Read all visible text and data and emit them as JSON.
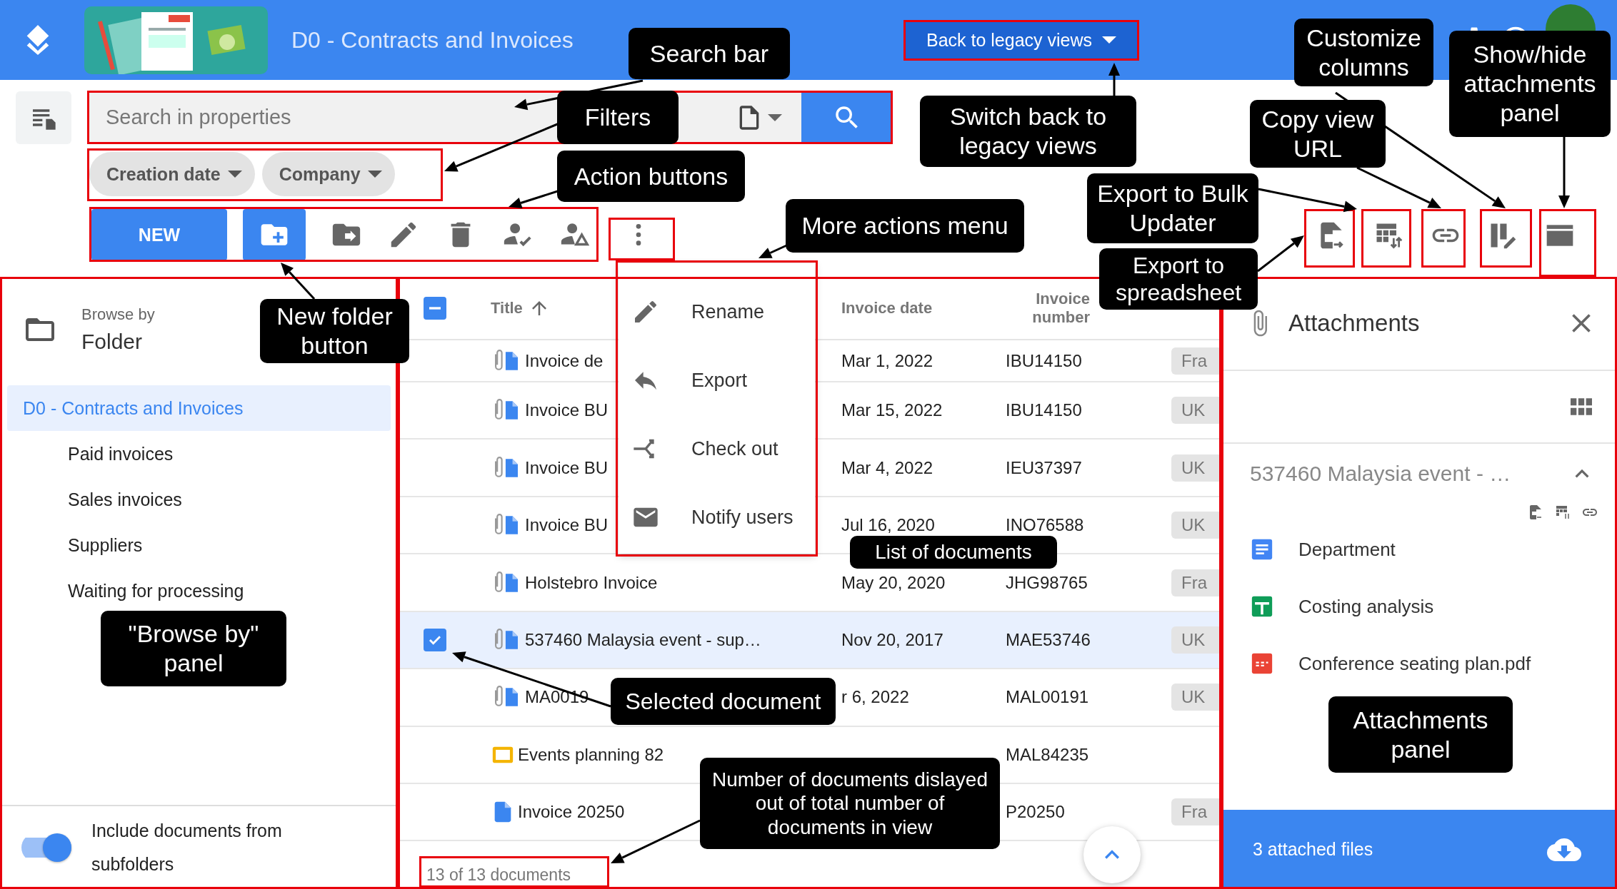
{
  "header": {
    "title": "D0 - Contracts and Invoices",
    "legacy_button": "Back to legacy views"
  },
  "search": {
    "placeholder": "Search in properties"
  },
  "filters": [
    {
      "label": "Creation date"
    },
    {
      "label": "Company"
    }
  ],
  "actions": {
    "new_button": "NEW"
  },
  "browse_panel": {
    "caption": "Browse by",
    "mode": "Folder",
    "tree": [
      {
        "label": "D0 - Contracts and Invoices",
        "selected": true,
        "children": [
          {
            "label": "Paid invoices",
            "selected": false
          },
          {
            "label": "Sales invoices",
            "selected": false
          },
          {
            "label": "Suppliers",
            "selected": false
          },
          {
            "label": "Waiting for processing",
            "selected": false
          }
        ]
      }
    ],
    "include_subfolders": {
      "label": "Include documents from subfolders",
      "on": true
    }
  },
  "document_list": {
    "select_all": {
      "mixed": true
    },
    "columns": [
      "Title",
      "Invoice date",
      "Invoice number"
    ],
    "rows": [
      {
        "kind": "attached-doc",
        "title": "Invoice de",
        "date": "Mar 1, 2022",
        "number": "IBU14150",
        "tag": "Fra",
        "selected": false
      },
      {
        "kind": "attached-doc",
        "title": "Invoice BU",
        "date": "Mar 15, 2022",
        "number": "IBU14150",
        "tag": "UK",
        "selected": false
      },
      {
        "kind": "attached-doc",
        "title": "Invoice BU",
        "date": "Mar 4, 2022",
        "number": "IEU37397",
        "tag": "UK",
        "selected": false
      },
      {
        "kind": "attached-doc",
        "title": "Invoice BU",
        "date": "Jul 16, 2020",
        "number": "INO76588",
        "tag": "UK",
        "selected": false
      },
      {
        "kind": "attached-doc",
        "title": "Holstebro Invoice",
        "date": "May 20, 2020",
        "number": "JHG98765",
        "tag": "Fra",
        "selected": false
      },
      {
        "kind": "attached-doc",
        "title": "537460 Malaysia event - sup…",
        "date": "Nov 20, 2017",
        "number": "MAE53746",
        "tag": "UK",
        "selected": true
      },
      {
        "kind": "attached-doc",
        "title": "MA0019",
        "date": "r 6, 2022",
        "number": "MAL00191",
        "tag": "UK",
        "selected": false
      },
      {
        "kind": "slides",
        "title": "Events planning 82",
        "number": "MAL84235",
        "selected": false
      },
      {
        "kind": "doc",
        "title": "Invoice 20250",
        "number": "P20250",
        "tag": "Fra",
        "selected": false
      }
    ],
    "count": "13 of 13 documents"
  },
  "more_actions_menu": {
    "items": [
      "Rename",
      "Export",
      "Check out",
      "Notify users"
    ]
  },
  "attachments_panel": {
    "title": "Attachments",
    "document": "537460 Malaysia event - …",
    "expanded": true,
    "files": [
      {
        "name": "Department",
        "kind": "doc"
      },
      {
        "name": "Costing analysis",
        "kind": "sheet"
      },
      {
        "name": "Conference seating plan.pdf",
        "kind": "pdf"
      }
    ],
    "footer": "3 attached files"
  },
  "annotations": [
    "Search bar",
    "Filters",
    "Switch back to legacy views",
    "Customize columns",
    "Copy view URL",
    "Show/hide attachments panel",
    "Action buttons",
    "More actions menu",
    "Export to Bulk Updater",
    "New folder button",
    "Export to spreadsheet",
    "List of documents",
    "\"Browse by\" panel",
    "Selected document",
    "Number of documents dislayed out of total number of documents in view",
    "Attachments panel"
  ]
}
